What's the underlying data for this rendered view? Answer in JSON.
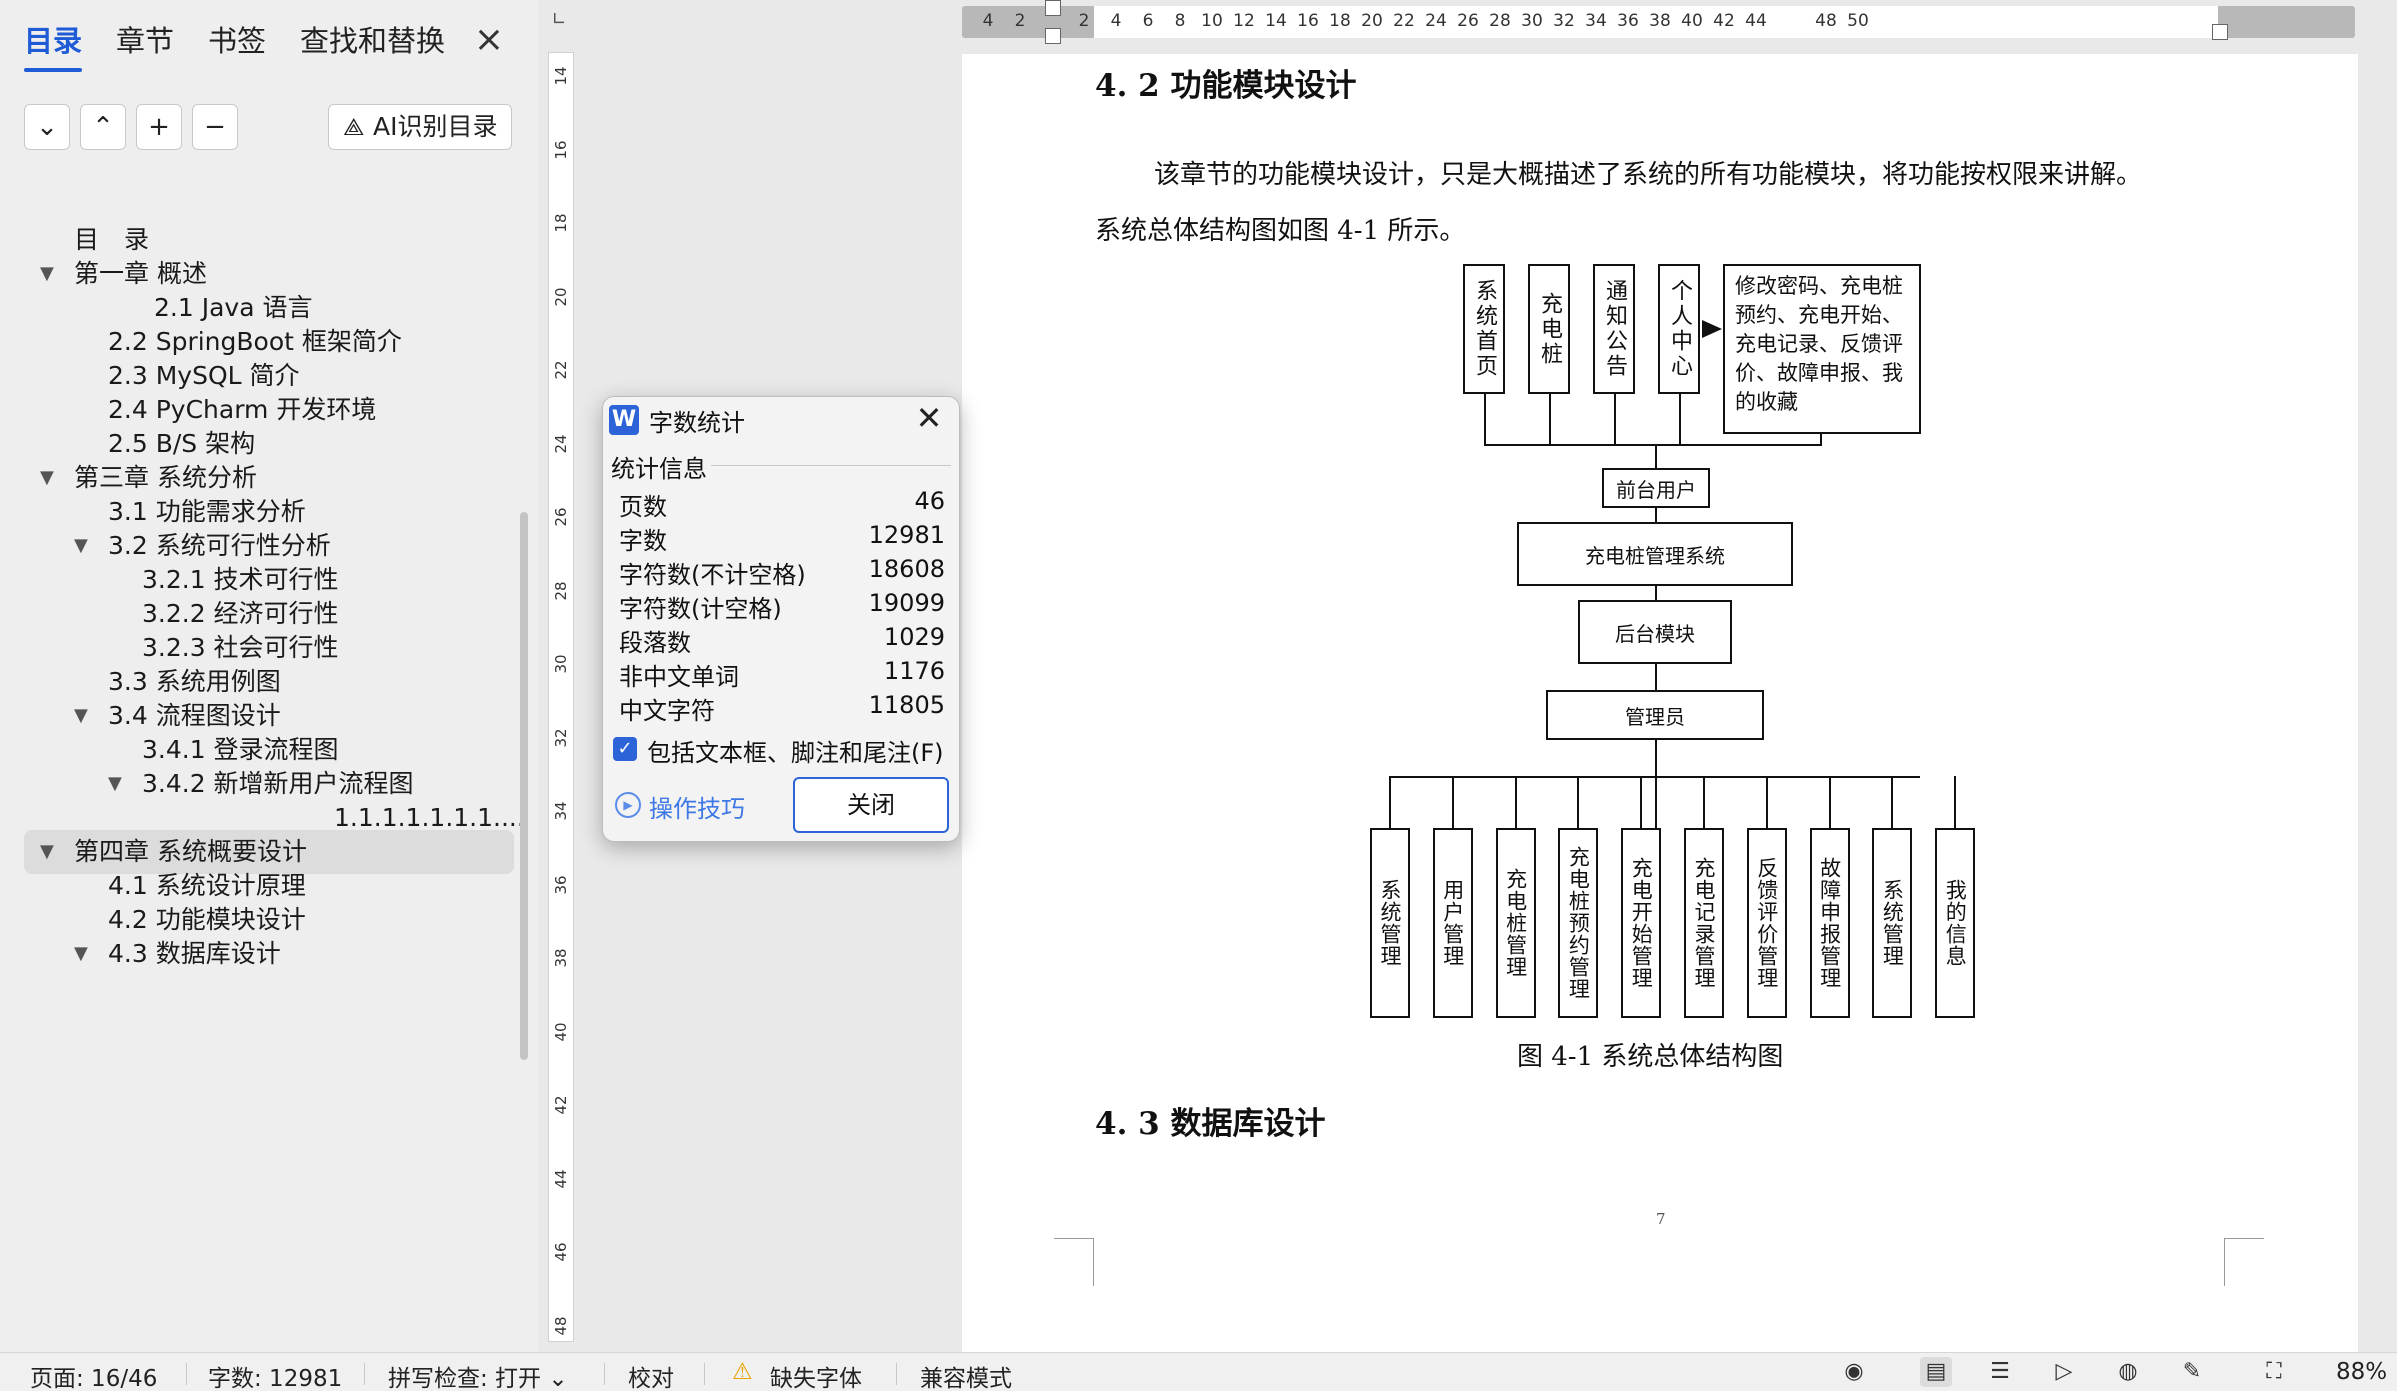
{
  "nav": {
    "tabs": [
      "目录",
      "章节",
      "书签",
      "查找和替换"
    ],
    "close": "×",
    "tools": [
      {
        "name": "expand-down",
        "glyph": "⌄"
      },
      {
        "name": "collapse-up",
        "glyph": "⌃"
      },
      {
        "name": "add",
        "glyph": "+"
      },
      {
        "name": "remove",
        "glyph": "−"
      }
    ],
    "ai_button": "AI识别目录",
    "toc": [
      {
        "text": "目　录",
        "level": 0,
        "tri": ""
      },
      {
        "text": "第一章  概述",
        "level": 0,
        "tri": "▼"
      },
      {
        "text": "2.1 Java  语言",
        "level": 3,
        "tri": ""
      },
      {
        "text": "2.2 SpringBoot 框架简介",
        "level": 1,
        "tri": ""
      },
      {
        "text": "2.3 MySQL 简介",
        "level": 1,
        "tri": ""
      },
      {
        "text": "2.4 PyCharm 开发环境",
        "level": 1,
        "tri": ""
      },
      {
        "text": "2.5 B/S 架构",
        "level": 1,
        "tri": ""
      },
      {
        "text": "第三章  系统分析",
        "level": 0,
        "tri": "▼"
      },
      {
        "text": "3.1 功能需求分析",
        "level": 1,
        "tri": ""
      },
      {
        "text": "3.2 系统可行性分析",
        "level": 1,
        "tri": "▼"
      },
      {
        "text": "3.2.1 技术可行性",
        "level": 2,
        "tri": ""
      },
      {
        "text": "3.2.2  经济可行性",
        "level": 2,
        "tri": ""
      },
      {
        "text": "3.2.3 社会可行性",
        "level": 2,
        "tri": ""
      },
      {
        "text": "3.3 系统用例图",
        "level": 1,
        "tri": ""
      },
      {
        "text": "3.4 流程图设计",
        "level": 1,
        "tri": "▼"
      },
      {
        "text": "3.4.1  登录流程图",
        "level": 2,
        "tri": ""
      },
      {
        "text": "3.4.2  新增新用户流程图",
        "level": 2,
        "tri": "▼"
      },
      {
        "text": "1.1.1.1.1.1.1....",
        "level": 4,
        "tri": ""
      },
      {
        "text": "第四章  系统概要设计",
        "level": 0,
        "tri": "▼",
        "active": true
      },
      {
        "text": "4.1 系统设计原理",
        "level": 1,
        "tri": ""
      },
      {
        "text": "4.2 功能模块设计",
        "level": 1,
        "tri": ""
      },
      {
        "text": "4.3  数据库设计",
        "level": 1,
        "tri": "▼"
      }
    ]
  },
  "ruler": {
    "corner": "∟",
    "h_ticks": [
      "4",
      "2",
      "2",
      "4",
      "6",
      "8",
      "10",
      "12",
      "14",
      "16",
      "18",
      "20",
      "22",
      "24",
      "26",
      "28",
      "30",
      "32",
      "34",
      "36",
      "38",
      "40",
      "42",
      "44",
      "48",
      "50"
    ],
    "v_ticks": [
      "14",
      "16",
      "18",
      "20",
      "22",
      "24",
      "26",
      "28",
      "30",
      "32",
      "34",
      "36",
      "38",
      "40",
      "42",
      "44",
      "46",
      "48"
    ]
  },
  "document": {
    "heading_42": "4. 2 功能模块设计",
    "para_line1": "该章节的功能模块设计，只是大概描述了系统的所有功能模块，将功能按权限来讲解。",
    "para_line2": "系统总体结构图如图 4-1 所示。",
    "diagram": {
      "top_boxes": [
        "系统首页",
        "充电桩",
        "通知公告",
        "个人中心"
      ],
      "personal_detail": "修改密码、充电桩预约、充电开始、充电记录、反馈评价、故障申报、我的收藏",
      "front_user": "前台用户",
      "system": "充电桩管理系统",
      "backend": "后台模块",
      "admin": "管理员",
      "bottom_boxes": [
        "系统管理",
        "用户管理",
        "充电桩管理",
        "充电桩预约管理",
        "充电开始管理",
        "充电记录管理",
        "反馈评价管理",
        "故障申报管理",
        "系统管理",
        "我的信息"
      ]
    },
    "figure_caption": "图 4-1  系统总体结构图",
    "heading_43": "4. 3  数据库设计",
    "page_number": "7"
  },
  "dialog": {
    "logo": "W",
    "title": "字数统计",
    "close": "✕",
    "section": "统计信息",
    "stats": [
      {
        "label": "页数",
        "value": "46"
      },
      {
        "label": "字数",
        "value": "12981"
      },
      {
        "label": "字符数(不计空格)",
        "value": "18608"
      },
      {
        "label": "字符数(计空格)",
        "value": "19099"
      },
      {
        "label": "段落数",
        "value": "1029"
      },
      {
        "label": "非中文单词",
        "value": "1176"
      },
      {
        "label": "中文字符",
        "value": "11805"
      }
    ],
    "checkbox_label": "包括文本框、脚注和尾注(F)",
    "checkbox_checked": true,
    "tips": "操作技巧",
    "close_button": "关闭"
  },
  "status": {
    "page": "页面: 16/46",
    "words": "字数: 12981",
    "spell": "拼写检查: 打开 ⌄",
    "proof": "校对",
    "missing_font": "缺失字体",
    "compat": "兼容模式",
    "zoom": "88%",
    "icons": [
      "eye-icon",
      "page-view-icon",
      "outline-view-icon",
      "play-icon",
      "web-icon",
      "pen-icon",
      "fit-icon"
    ]
  },
  "colors": {
    "accent": "#1f5bd6",
    "warning": "#e8a300"
  }
}
